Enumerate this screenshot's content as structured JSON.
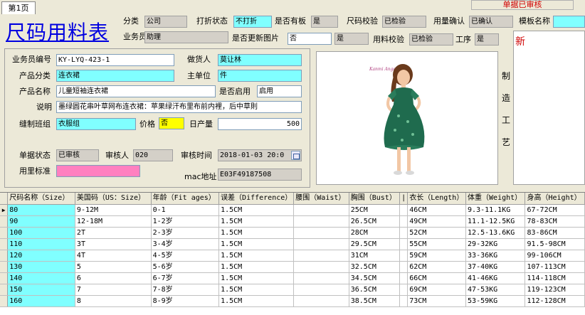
{
  "tab": {
    "label": "第1页"
  },
  "header_button": "单据已审核",
  "title": "尺码用料表",
  "top_fields": {
    "category_label": "分类",
    "category_value": "公司",
    "discount_status_label": "打折状态",
    "discount_status_value": "不打折",
    "has_sample_label": "是否有板",
    "has_sample_value": "是",
    "size_check_label": "尺码校验",
    "size_check_value": "已检验",
    "usage_confirm_label": "用量确认",
    "usage_confirm_value": "已确认",
    "template_name_label": "模板名称",
    "template_name_value": "",
    "salesperson_label": "业务员",
    "salesperson_value": "助理",
    "update_image_label": "是否更新图片",
    "update_image_value": "否",
    "update_image_extra": "是",
    "material_check_label": "用料校验",
    "material_check_value": "已检验",
    "process_label": "工序",
    "process_value": "是"
  },
  "form": {
    "sales_no_label": "业务员编号",
    "sales_no_value": "KY-LYQ-423-1",
    "maker_label": "做货人",
    "maker_value": "莫让林",
    "product_category_label": "产品分类",
    "product_category_value": "连衣裙",
    "main_unit_label": "主单位",
    "main_unit_value": "件",
    "product_name_label": "产品名称",
    "product_name_value": "儿童短袖连衣裙",
    "enabled_label": "是否启用",
    "enabled_value": "启用",
    "description_label": "说明",
    "description_value": "墨绿圆花串叶草网布连衣裙：苹果绿汗布里布前内裡，后中草則",
    "sewing_group_label": "缝制班组",
    "sewing_group_value": "衣服组",
    "price_label": "价格",
    "price_value": "否",
    "daily_output_label": "日产量",
    "daily_output_value": "500",
    "doc_status_label": "单据状态",
    "doc_status_value": "已审核",
    "reviewer_label": "审核人",
    "reviewer_value": "020",
    "review_time_label": "审核时间",
    "review_time_value": "2018-01-03  20:0",
    "usage_standard_label": "用里标准",
    "usage_standard_value": "",
    "mac_label": "mac地址",
    "mac_value": "E03F49187508"
  },
  "vertical_label": [
    "制",
    "造",
    "工",
    "艺"
  ],
  "note_text": "新",
  "table": {
    "columns": [
      "尺码名称（Size）",
      "美国码（US：Size）",
      "年龄（Fit ages）",
      "误差（Difference）",
      "腰围（Waist）",
      "胸围（Bust）",
      "|",
      "衣长（Length）",
      "体重（Weight）",
      "身高（Height）"
    ],
    "rows": [
      [
        "80",
        "9-12M",
        "0-1",
        "1.5CM",
        "",
        "25CM",
        "",
        "46CM",
        "9.3-11.1KG",
        "67-72CM"
      ],
      [
        "90",
        "12-18M",
        "1-2岁",
        "1.5CM",
        "",
        "26.5CM",
        "",
        "49CM",
        "11.1-12.5KG",
        "78-83CM"
      ],
      [
        "100",
        "2T",
        "2-3岁",
        "1.5CM",
        "",
        "28CM",
        "",
        "52CM",
        "12.5-13.6KG",
        "83-86CM"
      ],
      [
        "110",
        "3T",
        "3-4岁",
        "1.5CM",
        "",
        "29.5CM",
        "",
        "55CM",
        "29-32KG",
        "91.5-98CM"
      ],
      [
        "120",
        "4T",
        "4-5岁",
        "1.5CM",
        "",
        "31CM",
        "",
        "59CM",
        "33-36KG",
        "99-106CM"
      ],
      [
        "130",
        "5",
        "5-6岁",
        "1.5CM",
        "",
        "32.5CM",
        "",
        "62CM",
        "37-40KG",
        "107-113CM"
      ],
      [
        "140",
        "6",
        "6-7岁",
        "1.5CM",
        "",
        "34.5CM",
        "",
        "66CM",
        "41-46KG",
        "114-118CM"
      ],
      [
        "150",
        "7",
        "7-8岁",
        "1.5CM",
        "",
        "36.5CM",
        "",
        "69CM",
        "47-53KG",
        "119-123CM"
      ],
      [
        "160",
        "8",
        "8-9岁",
        "1.5CM",
        "",
        "38.5CM",
        "",
        "73CM",
        "53-59KG",
        "112-128CM"
      ]
    ]
  },
  "colors": {
    "title": "#0000e0",
    "highlight_cyan": "#80ffff",
    "pink": "#ff80c0",
    "yellow": "#ffff00",
    "status_red": "#d00000"
  }
}
